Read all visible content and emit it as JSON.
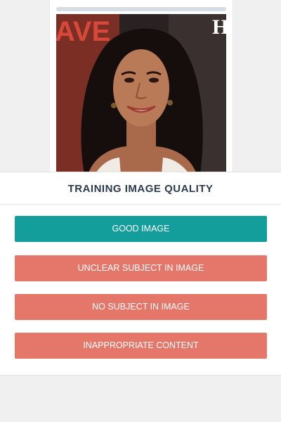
{
  "image_card": {
    "photo_icon": "portrait-photo",
    "banner_text": "AVE",
    "banner_corner": "H"
  },
  "panel": {
    "title": "TRAINING IMAGE QUALITY"
  },
  "buttons": {
    "good": "GOOD IMAGE",
    "unclear": "UNCLEAR SUBJECT IN IMAGE",
    "no_subject": "NO SUBJECT IN IMAGE",
    "inappropriate": "INAPPROPRIATE CONTENT"
  },
  "colors": {
    "good": "#139d9b",
    "bad": "#e5776a",
    "title": "#2c3a4e"
  }
}
